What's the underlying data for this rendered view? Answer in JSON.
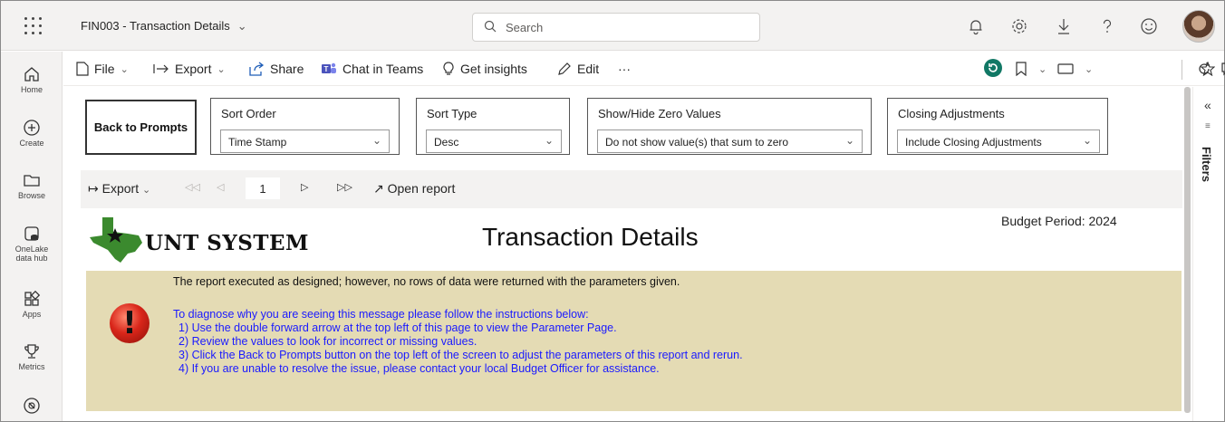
{
  "app": {
    "title": "FIN003 - Transaction Details",
    "search_placeholder": "Search",
    "accent": "#117865"
  },
  "leftnav": {
    "items": [
      {
        "label": "Home"
      },
      {
        "label": "Create"
      },
      {
        "label": "Browse"
      },
      {
        "label": "OneLake data hub"
      },
      {
        "label": "Apps"
      },
      {
        "label": "Metrics"
      }
    ]
  },
  "command_bar": {
    "file": "File",
    "export": "Export",
    "share": "Share",
    "chat": "Chat in Teams",
    "insights": "Get insights",
    "edit": "Edit",
    "more": "···"
  },
  "filters_pane": {
    "label": "Filters"
  },
  "prompts": {
    "back_button": "Back to Prompts",
    "sort_order": {
      "label": "Sort Order",
      "value": "Time Stamp"
    },
    "sort_type": {
      "label": "Sort Type",
      "value": "Desc"
    },
    "zero_values": {
      "label": "Show/Hide Zero Values",
      "value": "Do not show value(s) that sum to zero"
    },
    "closing_adjustments": {
      "label": "Closing Adjustments",
      "value": "Include Closing Adjustments"
    }
  },
  "report_toolbar": {
    "export": "Export",
    "page": "1",
    "open_report": "Open report"
  },
  "report": {
    "logo_text": "UNT SYSTEM",
    "title": "Transaction Details",
    "budget_period": "Budget Period: 2024",
    "message_main": "The report executed as designed; however, no rows of data were returned with the parameters given.",
    "message_lines": [
      "To diagnose why you are seeing this message please follow the instructions below:",
      "  1) Use the double forward arrow at the top left of this page to view the Parameter Page.",
      "  2) Review the values to look for incorrect or missing values.",
      "  3) Click the Back to Prompts button on the top left of the screen to adjust the parameters of this report and rerun.",
      "  4) If you are unable to resolve the issue, please contact your local  Budget Officer for assistance."
    ]
  }
}
